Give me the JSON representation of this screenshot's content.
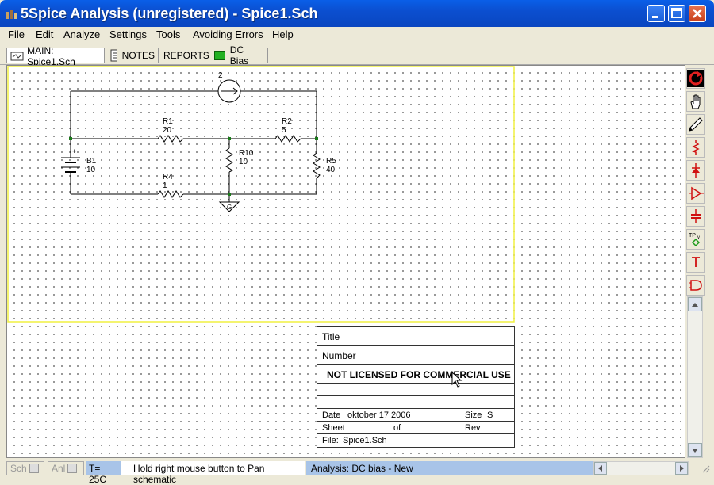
{
  "window": {
    "title": "5Spice Analysis (unregistered) - Spice1.Sch"
  },
  "menu": [
    "File",
    "Edit",
    "Analyze",
    "Settings",
    "Tools",
    "Avoiding Errors",
    "Help"
  ],
  "tabs": {
    "main": "MAIN:  Spice1.Sch",
    "notes": "NOTES",
    "reports": "REPORTS",
    "dcbias": "DC Bias"
  },
  "schematic": {
    "current_source": "2",
    "battery_name": "B1",
    "battery_value": "10",
    "battery_plus": "+",
    "r1_name": "R1",
    "r1_value": "20",
    "r2_name": "R2",
    "r2_value": "5",
    "r10_name": "R10",
    "r10_value": "10",
    "r5_name": "R5",
    "r5_value": "40",
    "r4_name": "R4",
    "r4_value": "1",
    "ground_label": "G"
  },
  "title_block": {
    "title": "Title",
    "number": "Number",
    "license": "NOT LICENSED FOR COMMERCIAL USE",
    "date_label": "Date",
    "date_value": "oktober 17 2006",
    "size_label": "Size",
    "size_value": "S",
    "sheet_label": "Sheet",
    "of_label": "of",
    "rev_label": "Rev",
    "file_label": "File:",
    "file_value": "Spice1.Sch"
  },
  "status": {
    "sch": "Sch",
    "anl": "Anl",
    "temp": "T= 25C",
    "hint": "Hold right mouse button to Pan schematic",
    "analysis": "Analysis:  DC bias - New"
  },
  "colors": {
    "titlebar": "#0a54e0",
    "wire": "#000000",
    "node": "#1a7a1a",
    "tool_red": "#d01010",
    "status_analysis": "#a8c4e8",
    "page_border": "#f0f040"
  }
}
